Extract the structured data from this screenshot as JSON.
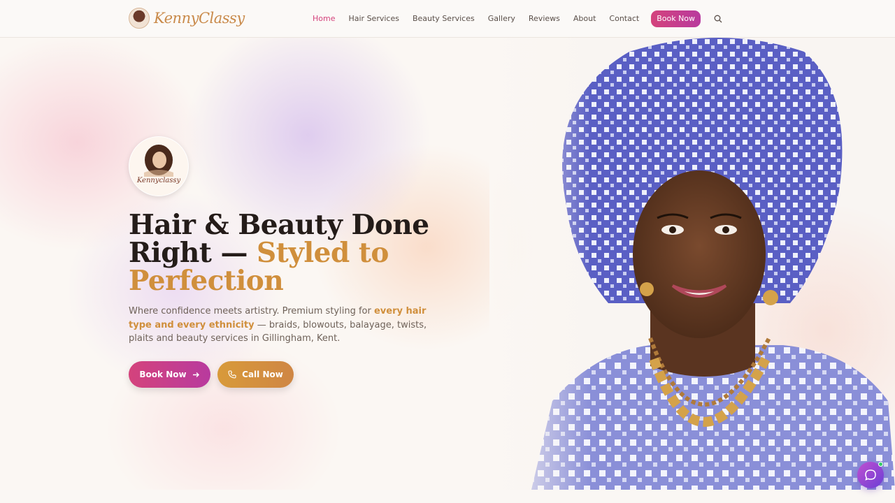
{
  "header": {
    "logo_text": "KennyClassy",
    "nav": [
      "Home",
      "Hair Services",
      "Beauty Services",
      "Gallery",
      "Reviews",
      "About",
      "Contact"
    ],
    "book_label": "Book Now"
  },
  "hero": {
    "badge_text": "Kennyclassy",
    "headline_1": "Hair & Beauty Done Right — ",
    "headline_gold": "Styled to Perfection",
    "sub_1": "Where confidence meets artistry. Premium styling for ",
    "sub_highlight": "every hair type and every ethnicity",
    "sub_2": " — braids, blowouts, balayage, twists, plaits and beauty services in Gillingham, Kent.",
    "book_button": "Book Now",
    "call_button": "Call Now"
  },
  "colors": {
    "accent_pink": "#d4437c",
    "accent_gold": "#d08f3c",
    "accent_purple": "#b83a9e"
  }
}
